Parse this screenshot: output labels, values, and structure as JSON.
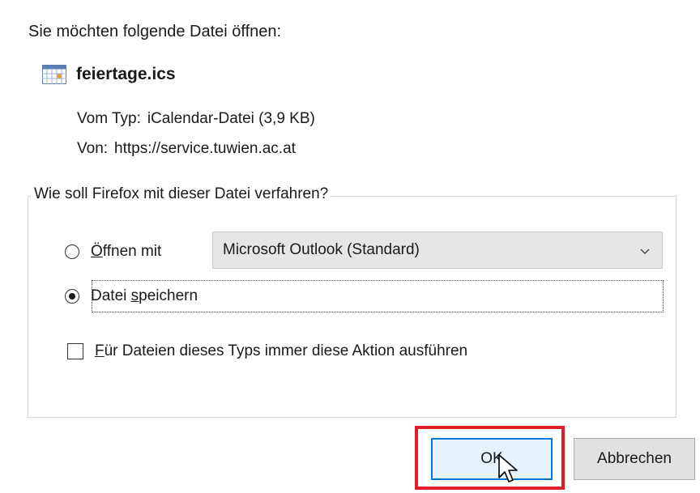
{
  "dialog": {
    "intro": "Sie möchten folgende Datei öffnen:",
    "file_name": "feiertage.ics",
    "type_label": "Vom Typ:",
    "type_value": "iCalendar-Datei (3,9 KB)",
    "from_label": "Von:",
    "from_value": "https://service.tuwien.ac.at",
    "group_legend": "Wie soll Firefox mit dieser Datei verfahren?",
    "open_with": {
      "first": "Ö",
      "rest": "ffnen mit",
      "selected": false
    },
    "app_select": {
      "value": "Microsoft Outlook (Standard)"
    },
    "save_file": {
      "pre": "Datei ",
      "u": "s",
      "rest": "peichern",
      "selected": true
    },
    "always": {
      "first": "F",
      "rest": "ür Dateien dieses Typs immer diese Aktion ausführen",
      "checked": false
    },
    "buttons": {
      "ok": "OK",
      "cancel": "Abbrechen"
    },
    "icons": {
      "file": "calendar-icon",
      "dropdown": "chevron-down-icon",
      "cursor": "mouse-pointer-icon"
    },
    "colors": {
      "highlight": "#e11d2b",
      "ok_border": "#0078d7",
      "ok_fill": "#e5f1fb"
    }
  }
}
